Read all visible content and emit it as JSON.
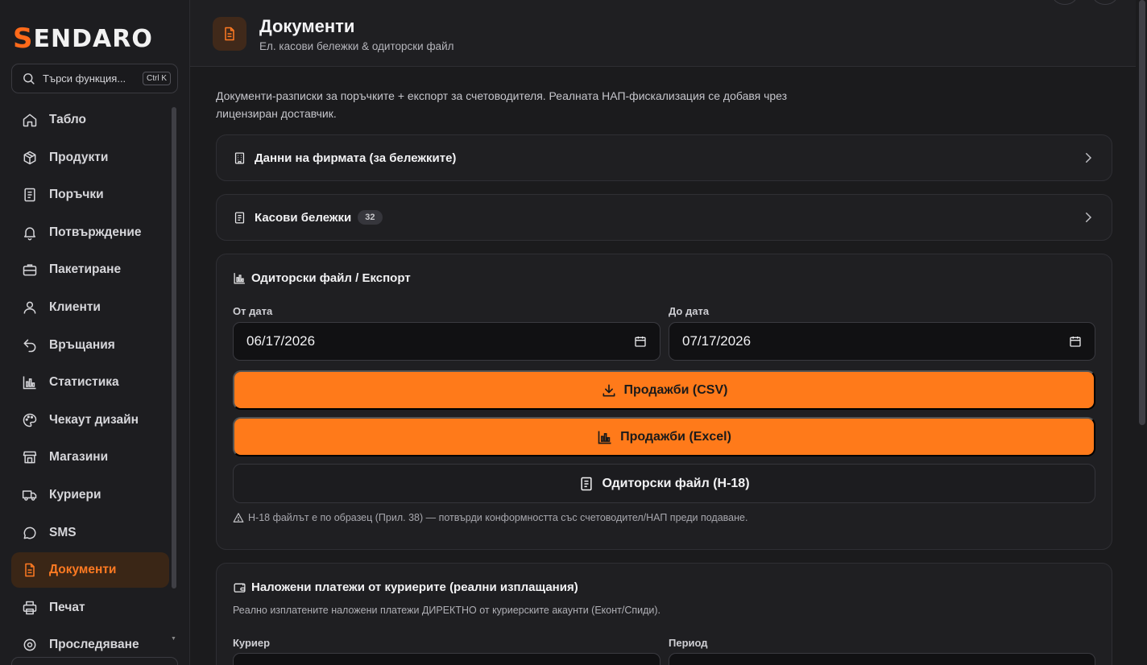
{
  "brand": {
    "logo_first": "S",
    "logo_rest": "ENDARO"
  },
  "search": {
    "placeholder": "Търси функция...",
    "shortcut": "Ctrl K"
  },
  "sidebar": {
    "items": [
      {
        "label": "Табло",
        "icon": "home-icon"
      },
      {
        "label": "Продукти",
        "icon": "box-icon"
      },
      {
        "label": "Поръчки",
        "icon": "receipt-icon"
      },
      {
        "label": "Потвърждение",
        "icon": "bell-icon"
      },
      {
        "label": "Пакетиране",
        "icon": "briefcase-icon"
      },
      {
        "label": "Клиенти",
        "icon": "user-icon"
      },
      {
        "label": "Връщания",
        "icon": "undo-icon"
      },
      {
        "label": "Статистика",
        "icon": "bar-chart-icon"
      },
      {
        "label": "Чекаут дизайн",
        "icon": "palette-icon"
      },
      {
        "label": "Магазини",
        "icon": "store-icon"
      },
      {
        "label": "Куриери",
        "icon": "truck-icon"
      },
      {
        "label": "SMS",
        "icon": "chat-icon"
      },
      {
        "label": "Документи",
        "icon": "document-icon",
        "active": true
      },
      {
        "label": "Печат",
        "icon": "printer-icon"
      },
      {
        "label": "Проследяване",
        "icon": "location-icon"
      }
    ]
  },
  "header": {
    "title": "Документи",
    "subtitle": "Ел. касови бележки & одиторски файл"
  },
  "intro": "Документи-разписки за поръчките + експорт за счетоводителя. Реалната НАП-фискализация се добавя чрез лицензиран доставчик.",
  "company_card": {
    "title": "Данни на фирмата (за бележките)"
  },
  "receipts_card": {
    "title": "Касови бележки",
    "count": "32"
  },
  "export_card": {
    "title": "Одиторски файл / Експорт",
    "from_label": "От дата",
    "from_value": "06/17/2026",
    "to_label": "До дата",
    "to_value": "07/17/2026",
    "btn_csv": "Продажби (CSV)",
    "btn_excel": "Продажби (Excel)",
    "btn_audit": "Одиторски файл (Н-18)",
    "note": "Н-18 файлът е по образец (Прил. 38) — потвърди конформността със счетоводител/НАП преди подаване."
  },
  "cod_card": {
    "title": "Наложени платежи от куриерите (реални изплащания)",
    "desc": "Реално изплатените наложени платежи ДИРЕКТНО от куриерските акаунти (Еконт/Спиди).",
    "courier_label": "Куриер",
    "period_label": "Период"
  },
  "colors": {
    "accent": "#ff7a1a",
    "background": "#1b1b1d"
  }
}
